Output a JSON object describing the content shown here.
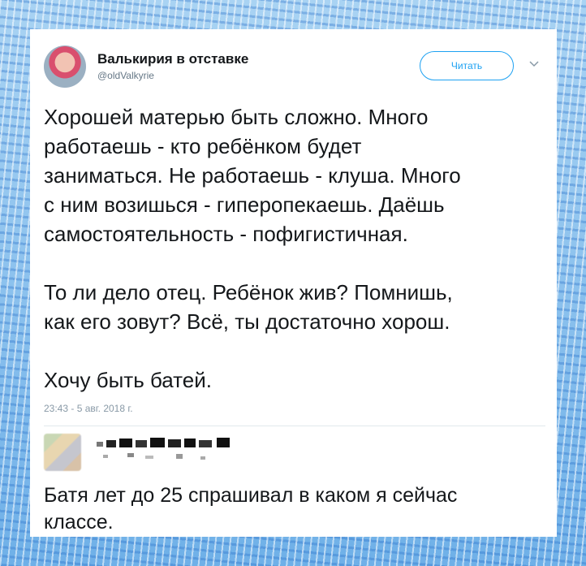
{
  "tweet": {
    "author": {
      "display_name": "Валькирия в отставке",
      "handle": "@oldValkyrie"
    },
    "follow_label": "Читать",
    "text_paragraphs": [
      "Хорошей матерью быть сложно. Много\nработаешь - кто ребёнком будет\nзаниматься. Не работаешь - клуша. Много\nс ним возишься - гиперопекаешь. Даёшь\nсамостоятельность - пофигистичная.",
      "То ли дело отец. Ребёнок жив? Помнишь,\nкак его зовут? Всё, ты достаточно хорош.",
      "Хочу быть батей."
    ],
    "timestamp": "23:43 - 5 авг. 2018 г."
  },
  "reply": {
    "text": "Батя лет до 25 спрашивал в каком я сейчас\nклассе."
  },
  "colors": {
    "accent": "#1da1f2",
    "text": "#14171a",
    "muted": "#657786"
  }
}
